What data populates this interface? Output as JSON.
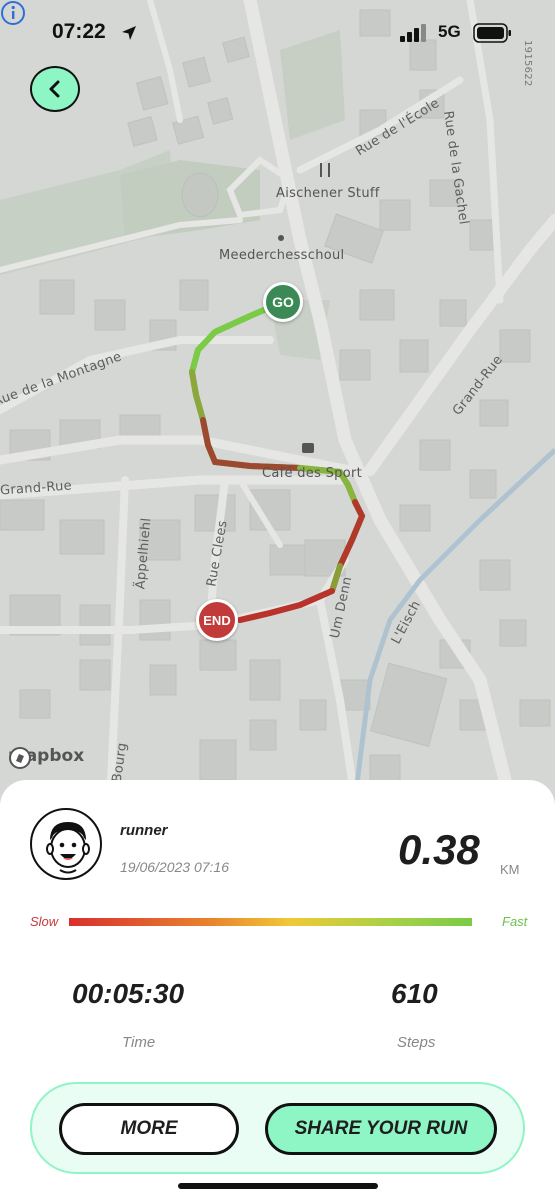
{
  "status_bar": {
    "time": "07:22",
    "network": "5G"
  },
  "map": {
    "labels": {
      "rue_ecole": "Rue de l'École",
      "rue_gachel": "Rue de la Gachel",
      "aischener_stuff": "Aischener Stuff",
      "meederchesschoul": "Meederchesschoul",
      "rue_montagne": "Rue de la Montagne",
      "grand_rue_left": "Grand-Rue",
      "grand_rue_right": "Grand-Rue",
      "cafe_sport": "Café des Sport",
      "appelhiehl": "Äppelhiehl",
      "rue_clees": "Rue Clees",
      "um_denn": "Um Denn",
      "lesch": "L'Eisch",
      "bourg": "Bourg",
      "map_code": "1915622"
    },
    "markers": {
      "start": "GO",
      "end": "END"
    },
    "attribution": "mapbox"
  },
  "run": {
    "runner": "runner",
    "date": "19/06/2023 07:16",
    "distance": "0.38",
    "distance_unit": "KM",
    "speed_legend": {
      "slow": "Slow",
      "fast": "Fast"
    },
    "time_value": "00:05:30",
    "time_label": "Time",
    "steps_value": "610",
    "steps_label": "Steps"
  },
  "actions": {
    "more": "MORE",
    "share": "SHARE YOUR RUN"
  },
  "colors": {
    "accent": "#8ef5c4",
    "route_slow": "#c23a3a",
    "route_fast": "#7acb45",
    "start_marker": "#3b8a55",
    "end_marker": "#c23a3a"
  }
}
